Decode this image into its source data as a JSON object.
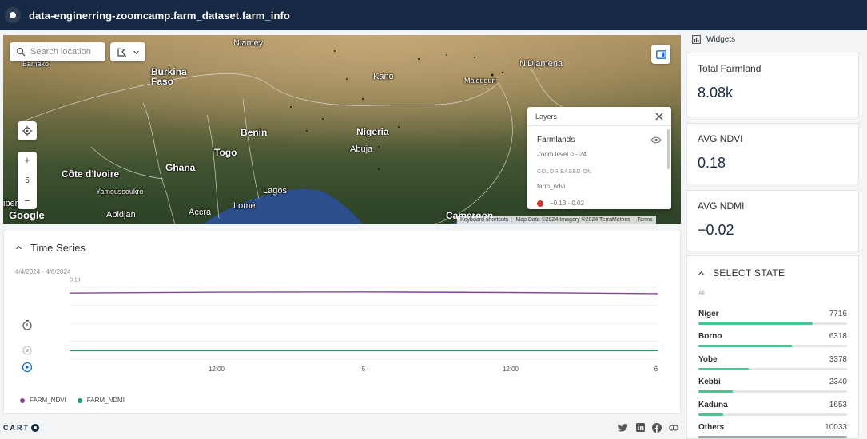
{
  "header": {
    "title": "data-enginerring-zoomcamp.farm_dataset.farm_info"
  },
  "map": {
    "search_placeholder": "Search location",
    "zoom_level": "5",
    "places": [
      {
        "name": "Niamey",
        "size": "normal"
      },
      {
        "name": "Burkina\nFaso",
        "size": "big"
      },
      {
        "name": "Bamako",
        "size": "small"
      },
      {
        "name": "Kano",
        "size": "normal"
      },
      {
        "name": "N'Djamena",
        "size": "normal"
      },
      {
        "name": "Maiduguri",
        "size": "small"
      },
      {
        "name": "Benin",
        "size": "big"
      },
      {
        "name": "Nigeria",
        "size": "big"
      },
      {
        "name": "Abuja",
        "size": "normal"
      },
      {
        "name": "Togo",
        "size": "big"
      },
      {
        "name": "Ghana",
        "size": "big"
      },
      {
        "name": "Côte d'Ivoire",
        "size": "big"
      },
      {
        "name": "Yamoussoukro",
        "size": "small"
      },
      {
        "name": "Lagos",
        "size": "normal"
      },
      {
        "name": "Accra",
        "size": "normal"
      },
      {
        "name": "Lomé",
        "size": "normal"
      },
      {
        "name": "Abidjan",
        "size": "normal"
      },
      {
        "name": "Cameroon",
        "size": "big"
      },
      {
        "name": "iber",
        "size": "normal"
      }
    ],
    "google_logo": "Google",
    "attribution": [
      "Keyboard shortcuts",
      "Map Data ©2024 Imagery ©2024 TerraMetrics",
      "Terms"
    ]
  },
  "layers_panel": {
    "title": "Layers",
    "layer_name": "Farmlands",
    "zoom_text": "Zoom level 0 - 24",
    "color_based_on": "COLOR BASED ON",
    "field": "farm_ndvi",
    "first_legend": "−0.13 - 0.02",
    "first_legend_color": "#d2322d"
  },
  "time_series": {
    "title": "Time Series",
    "range": "4/4/2024 - 4/6/2024",
    "y_tick": "0.19",
    "x_ticks": [
      "12:00",
      "5",
      "12:00",
      "6"
    ],
    "legend": [
      {
        "name": "FARM_NDVI",
        "color": "#8e3fa0"
      },
      {
        "name": "FARM_NDMI",
        "color": "#1a9e7a"
      }
    ]
  },
  "chart_data": {
    "type": "line",
    "title": "Time Series",
    "x": [
      "4/4/2024",
      "4/4/2024 12:00",
      "4/5/2024",
      "4/5/2024 12:00",
      "4/6/2024"
    ],
    "series": [
      {
        "name": "FARM_NDVI",
        "values": [
          0.18,
          0.183,
          0.184,
          0.182,
          0.178
        ]
      },
      {
        "name": "FARM_NDMI",
        "values": [
          -0.02,
          -0.02,
          -0.02,
          -0.02,
          -0.02
        ]
      }
    ],
    "ylim": [
      -0.05,
      0.2
    ],
    "grid": true,
    "legend": "bottom-left"
  },
  "widgets": {
    "header": "Widgets",
    "total_farmland": {
      "label": "Total Farmland",
      "value": "8.08k"
    },
    "avg_ndvi": {
      "label": "AVG NDVI",
      "value": "0.18"
    },
    "avg_ndmi": {
      "label": "AVG NDMI",
      "value": "−0.02"
    }
  },
  "select_state": {
    "title": "SELECT STATE",
    "all_label": "All",
    "max": 10033,
    "rows": [
      {
        "name": "Niger",
        "count": "7716",
        "value": 7716
      },
      {
        "name": "Borno",
        "count": "6318",
        "value": 6318
      },
      {
        "name": "Yobe",
        "count": "3378",
        "value": 3378
      },
      {
        "name": "Kebbi",
        "count": "2340",
        "value": 2340
      },
      {
        "name": "Kaduna",
        "count": "1653",
        "value": 1653
      },
      {
        "name": "Others",
        "count": "10033",
        "value": 10033
      }
    ]
  },
  "footer": {
    "brand": "CART"
  }
}
